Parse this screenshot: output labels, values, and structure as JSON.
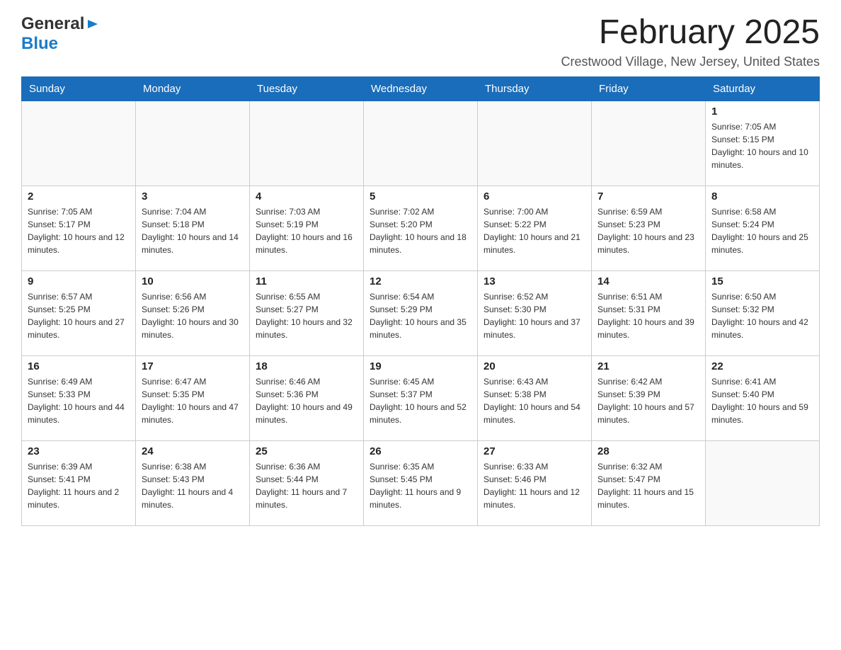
{
  "header": {
    "logo_general": "General",
    "logo_blue": "Blue",
    "month_title": "February 2025",
    "location": "Crestwood Village, New Jersey, United States"
  },
  "weekdays": [
    "Sunday",
    "Monday",
    "Tuesday",
    "Wednesday",
    "Thursday",
    "Friday",
    "Saturday"
  ],
  "weeks": [
    [
      {
        "day": "",
        "info": ""
      },
      {
        "day": "",
        "info": ""
      },
      {
        "day": "",
        "info": ""
      },
      {
        "day": "",
        "info": ""
      },
      {
        "day": "",
        "info": ""
      },
      {
        "day": "",
        "info": ""
      },
      {
        "day": "1",
        "info": "Sunrise: 7:05 AM\nSunset: 5:15 PM\nDaylight: 10 hours and 10 minutes."
      }
    ],
    [
      {
        "day": "2",
        "info": "Sunrise: 7:05 AM\nSunset: 5:17 PM\nDaylight: 10 hours and 12 minutes."
      },
      {
        "day": "3",
        "info": "Sunrise: 7:04 AM\nSunset: 5:18 PM\nDaylight: 10 hours and 14 minutes."
      },
      {
        "day": "4",
        "info": "Sunrise: 7:03 AM\nSunset: 5:19 PM\nDaylight: 10 hours and 16 minutes."
      },
      {
        "day": "5",
        "info": "Sunrise: 7:02 AM\nSunset: 5:20 PM\nDaylight: 10 hours and 18 minutes."
      },
      {
        "day": "6",
        "info": "Sunrise: 7:00 AM\nSunset: 5:22 PM\nDaylight: 10 hours and 21 minutes."
      },
      {
        "day": "7",
        "info": "Sunrise: 6:59 AM\nSunset: 5:23 PM\nDaylight: 10 hours and 23 minutes."
      },
      {
        "day": "8",
        "info": "Sunrise: 6:58 AM\nSunset: 5:24 PM\nDaylight: 10 hours and 25 minutes."
      }
    ],
    [
      {
        "day": "9",
        "info": "Sunrise: 6:57 AM\nSunset: 5:25 PM\nDaylight: 10 hours and 27 minutes."
      },
      {
        "day": "10",
        "info": "Sunrise: 6:56 AM\nSunset: 5:26 PM\nDaylight: 10 hours and 30 minutes."
      },
      {
        "day": "11",
        "info": "Sunrise: 6:55 AM\nSunset: 5:27 PM\nDaylight: 10 hours and 32 minutes."
      },
      {
        "day": "12",
        "info": "Sunrise: 6:54 AM\nSunset: 5:29 PM\nDaylight: 10 hours and 35 minutes."
      },
      {
        "day": "13",
        "info": "Sunrise: 6:52 AM\nSunset: 5:30 PM\nDaylight: 10 hours and 37 minutes."
      },
      {
        "day": "14",
        "info": "Sunrise: 6:51 AM\nSunset: 5:31 PM\nDaylight: 10 hours and 39 minutes."
      },
      {
        "day": "15",
        "info": "Sunrise: 6:50 AM\nSunset: 5:32 PM\nDaylight: 10 hours and 42 minutes."
      }
    ],
    [
      {
        "day": "16",
        "info": "Sunrise: 6:49 AM\nSunset: 5:33 PM\nDaylight: 10 hours and 44 minutes."
      },
      {
        "day": "17",
        "info": "Sunrise: 6:47 AM\nSunset: 5:35 PM\nDaylight: 10 hours and 47 minutes."
      },
      {
        "day": "18",
        "info": "Sunrise: 6:46 AM\nSunset: 5:36 PM\nDaylight: 10 hours and 49 minutes."
      },
      {
        "day": "19",
        "info": "Sunrise: 6:45 AM\nSunset: 5:37 PM\nDaylight: 10 hours and 52 minutes."
      },
      {
        "day": "20",
        "info": "Sunrise: 6:43 AM\nSunset: 5:38 PM\nDaylight: 10 hours and 54 minutes."
      },
      {
        "day": "21",
        "info": "Sunrise: 6:42 AM\nSunset: 5:39 PM\nDaylight: 10 hours and 57 minutes."
      },
      {
        "day": "22",
        "info": "Sunrise: 6:41 AM\nSunset: 5:40 PM\nDaylight: 10 hours and 59 minutes."
      }
    ],
    [
      {
        "day": "23",
        "info": "Sunrise: 6:39 AM\nSunset: 5:41 PM\nDaylight: 11 hours and 2 minutes."
      },
      {
        "day": "24",
        "info": "Sunrise: 6:38 AM\nSunset: 5:43 PM\nDaylight: 11 hours and 4 minutes."
      },
      {
        "day": "25",
        "info": "Sunrise: 6:36 AM\nSunset: 5:44 PM\nDaylight: 11 hours and 7 minutes."
      },
      {
        "day": "26",
        "info": "Sunrise: 6:35 AM\nSunset: 5:45 PM\nDaylight: 11 hours and 9 minutes."
      },
      {
        "day": "27",
        "info": "Sunrise: 6:33 AM\nSunset: 5:46 PM\nDaylight: 11 hours and 12 minutes."
      },
      {
        "day": "28",
        "info": "Sunrise: 6:32 AM\nSunset: 5:47 PM\nDaylight: 11 hours and 15 minutes."
      },
      {
        "day": "",
        "info": ""
      }
    ]
  ]
}
